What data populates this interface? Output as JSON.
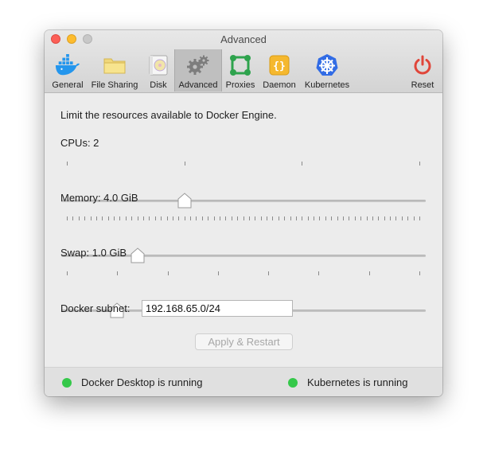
{
  "window": {
    "title": "Advanced"
  },
  "toolbar": {
    "tabs": [
      {
        "label": "General",
        "icon": "docker-whale-icon"
      },
      {
        "label": "File Sharing",
        "icon": "folder-icon"
      },
      {
        "label": "Disk",
        "icon": "disk-icon"
      },
      {
        "label": "Advanced",
        "icon": "gears-icon",
        "active": true
      },
      {
        "label": "Proxies",
        "icon": "proxies-icon"
      },
      {
        "label": "Daemon",
        "icon": "daemon-braces-icon"
      },
      {
        "label": "Kubernetes",
        "icon": "kubernetes-helm-icon"
      },
      {
        "label": "Reset",
        "icon": "power-icon"
      }
    ]
  },
  "content": {
    "intro": "Limit the resources available to Docker Engine.",
    "cpus": {
      "label": "CPUs: 2",
      "value": 2,
      "min": 1,
      "max": 4
    },
    "memory": {
      "label": "Memory: 4.0 GiB",
      "value": 4.0,
      "min": 1,
      "max": 16
    },
    "swap": {
      "label": "Swap: 1.0 GiB",
      "value": 1.0,
      "min": 0,
      "max": 4
    },
    "subnet": {
      "label": "Docker subnet:",
      "value": "192.168.65.0/24"
    },
    "apply_label": "Apply & Restart"
  },
  "status": {
    "docker": "Docker Desktop is running",
    "kubernetes": "Kubernetes is running",
    "running_color": "#35c84a"
  },
  "colors": {
    "close": "#fc5f57",
    "minimize": "#fdbc2e",
    "docker_blue": "#2496ed",
    "reset_red": "#e0463a",
    "kubernetes_blue": "#326ce5"
  }
}
